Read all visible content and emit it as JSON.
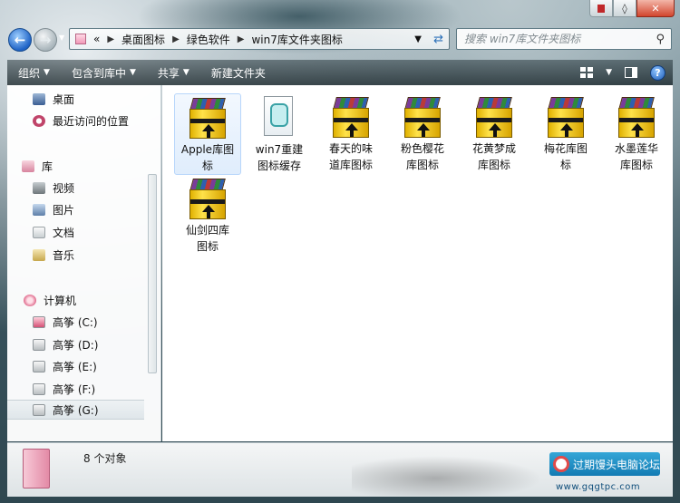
{
  "window": {
    "caption": {
      "minimize": "",
      "maximize": "◊",
      "close": "✕"
    }
  },
  "address": {
    "back": "←",
    "forward": "→",
    "prefix": "«",
    "path": [
      "桌面图标",
      "绿色软件",
      "win7库文件夹图标"
    ]
  },
  "search": {
    "placeholder": "搜索 win7库文件夹图标"
  },
  "toolbar": {
    "organize": "组织",
    "include_in_library": "包含到库中",
    "share": "共享",
    "new_folder": "新建文件夹"
  },
  "sidebar": {
    "favorites": [
      {
        "label": "桌面",
        "icon": "desktop-icon"
      },
      {
        "label": "最近访问的位置",
        "icon": "recent-places-icon"
      }
    ],
    "libraries_title": "库",
    "libraries": [
      {
        "label": "视频",
        "icon": "videos-icon"
      },
      {
        "label": "图片",
        "icon": "pictures-icon"
      },
      {
        "label": "文档",
        "icon": "documents-icon"
      },
      {
        "label": "音乐",
        "icon": "music-icon"
      }
    ],
    "computer_title": "计算机",
    "drives": [
      {
        "label": "高筝 (C:)"
      },
      {
        "label": "高筝 (D:)"
      },
      {
        "label": "高筝 (E:)"
      },
      {
        "label": "高筝 (F:)"
      },
      {
        "label": "高筝 (G:)"
      }
    ]
  },
  "files": [
    {
      "line1": "Apple库图",
      "line2": "标",
      "icon": "rar-archive-icon"
    },
    {
      "line1": "win7重建",
      "line2": "图标缓存",
      "icon": "script-file-icon"
    },
    {
      "line1": "春天的味",
      "line2": "道库图标",
      "icon": "rar-archive-icon"
    },
    {
      "line1": "粉色樱花",
      "line2": "库图标",
      "icon": "rar-archive-icon"
    },
    {
      "line1": "花黄梦成",
      "line2": "库图标",
      "icon": "rar-archive-icon"
    },
    {
      "line1": "梅花库图",
      "line2": "标",
      "icon": "rar-archive-icon"
    },
    {
      "line1": "水墨莲华",
      "line2": "库图标",
      "icon": "rar-archive-icon"
    },
    {
      "line1": "仙剑四库",
      "line2": "图标",
      "icon": "rar-archive-icon"
    }
  ],
  "status": {
    "count": "8 个对象"
  },
  "watermark": {
    "title": "过期馒头电脑论坛",
    "url": "www.gqgtpc.com"
  }
}
